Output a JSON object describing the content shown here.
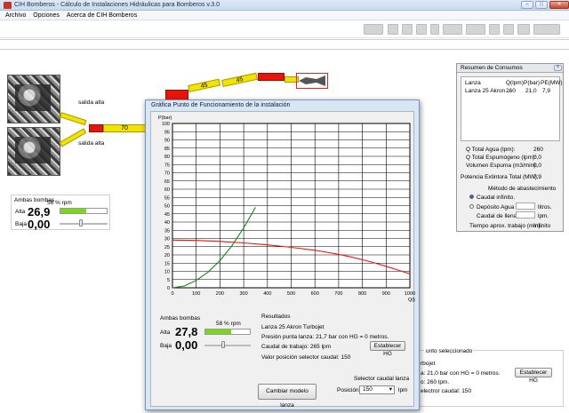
{
  "window": {
    "title": "CIH Bomberos - Cálculo de Instalaciones Hidráulicas para Bomberos v.3.0"
  },
  "menu": [
    "Archivo",
    "Opciones",
    "Acerca de CIH Bomberos"
  ],
  "toolbar": {
    "icons": [
      "nozzle-icon",
      "divider-icon",
      "valve-icon",
      "reducer-icon",
      "hose-icon",
      "pump-icon",
      "calc-icon",
      "grid-icon",
      "print-icon",
      "export-icon",
      "settings-icon"
    ]
  },
  "installation": {
    "outlet_label_1": "salida alta",
    "outlet_label_2": "salida alta",
    "hose_1_length": "70",
    "hose_2_length": "45",
    "hose_3_length": "45"
  },
  "bombs_main": {
    "title": "Ambas bombas",
    "rpm_label": "56 % rpm",
    "rpm_percent": 56,
    "alta_label": "Alta",
    "alta_value": "26,9",
    "baja_label": "Baja",
    "baja_value": "0,00",
    "slider_fraction": 0.45
  },
  "resumen": {
    "title": "Resumen de Consumos",
    "columns": [
      "Lanza",
      "Q(lpm)",
      "P(bar)",
      "PE(MW)"
    ],
    "rows": [
      [
        "Lanza 25 Akron ...",
        "260",
        "21,0",
        "7,9"
      ]
    ],
    "q_total_agua_label": "Q Total  Agua (lpm):",
    "q_total_agua": "260",
    "q_total_espumogeno_label": "Q Total Espumógeno (lpm):",
    "q_total_espumogeno": "0,0",
    "volumen_espuma_label": "Volumen Espuma (m3/min):",
    "volumen_espuma": "0,0",
    "potencia_label": "Potencia Extintora Total (MW):",
    "potencia": "7,9",
    "metodo_label": "Método de abastecimiento",
    "caudal_infinito_label": "Caudal infinito.",
    "deposito_label": "Depósito Agua con",
    "deposito_unit": "litros.",
    "caudal_llenado_label": "Caudal de llenado",
    "caudal_llenado_unit": "lpm.",
    "tiempo_label": "Tiempo aprox. trabajo (min):",
    "tiempo_value": "Infinito"
  },
  "background_lower": {
    "title": "unto seleccionado",
    "line1": "rbojet",
    "line2": "a: 21,0 bar con HG = 0 metros.",
    "line3": "o: 260 lpm.",
    "line4": "electror caudal: 150",
    "button": "Establecer HG"
  },
  "dialog": {
    "title": "Gráfica Punto de Funcionamiento de la instalación",
    "bombs_title": "Ambas bombas",
    "rpm_label": "58 % rpm",
    "rpm_percent": 58,
    "alta_label": "Alta",
    "alta_value": "27,8",
    "baja_label": "Baja",
    "baja_value": "0,00",
    "slider_fraction": 0.4,
    "resultados_title": "Resultados",
    "lanza": "Lanza 25 Akron Turbojet",
    "presion": "Presión punta lanza: 21,7 bar con HG = 0 metros.",
    "caudal": "Caudal de trabajo: 265 lpm",
    "valor_selector": "Valor posición selector caudal: 150",
    "establecer_button": "Establecer HG",
    "cambiar_button": "Cambiar modelo lanza",
    "selector_title": "Selector caudal lanza",
    "posicion_label": "Posición:",
    "posicion_value": "150",
    "posicion_unit": "lpm"
  },
  "chart_data": {
    "type": "line",
    "xlabel": "Q(lpm)",
    "ylabel": "P(bar)",
    "xlim": [
      0,
      1000
    ],
    "ylim": [
      0,
      100
    ],
    "x_ticks": [
      0,
      100,
      200,
      300,
      400,
      500,
      600,
      700,
      800,
      900,
      1000
    ],
    "y_ticks": [
      0,
      5,
      10,
      15,
      20,
      25,
      30,
      35,
      40,
      45,
      50,
      55,
      60,
      65,
      70,
      75,
      80,
      85,
      90,
      95,
      100
    ],
    "grid": true,
    "series": [
      {
        "color": "#e8150b",
        "x": [
          0,
          100,
          200,
          300,
          400,
          500,
          600,
          650,
          700,
          750,
          800,
          850,
          900,
          950,
          1000
        ],
        "y": [
          29,
          28.8,
          28.2,
          27.3,
          26.1,
          24.6,
          22.8,
          21.6,
          20.3,
          18.8,
          17.1,
          15.2,
          13.1,
          10.8,
          8.5
        ]
      },
      {
        "color": "#0b8a12",
        "x": [
          0,
          50,
          100,
          150,
          200,
          250,
          300,
          350
        ],
        "y": [
          0,
          1.1,
          4.5,
          9.5,
          16.5,
          25.5,
          36.5,
          49
        ]
      }
    ]
  }
}
